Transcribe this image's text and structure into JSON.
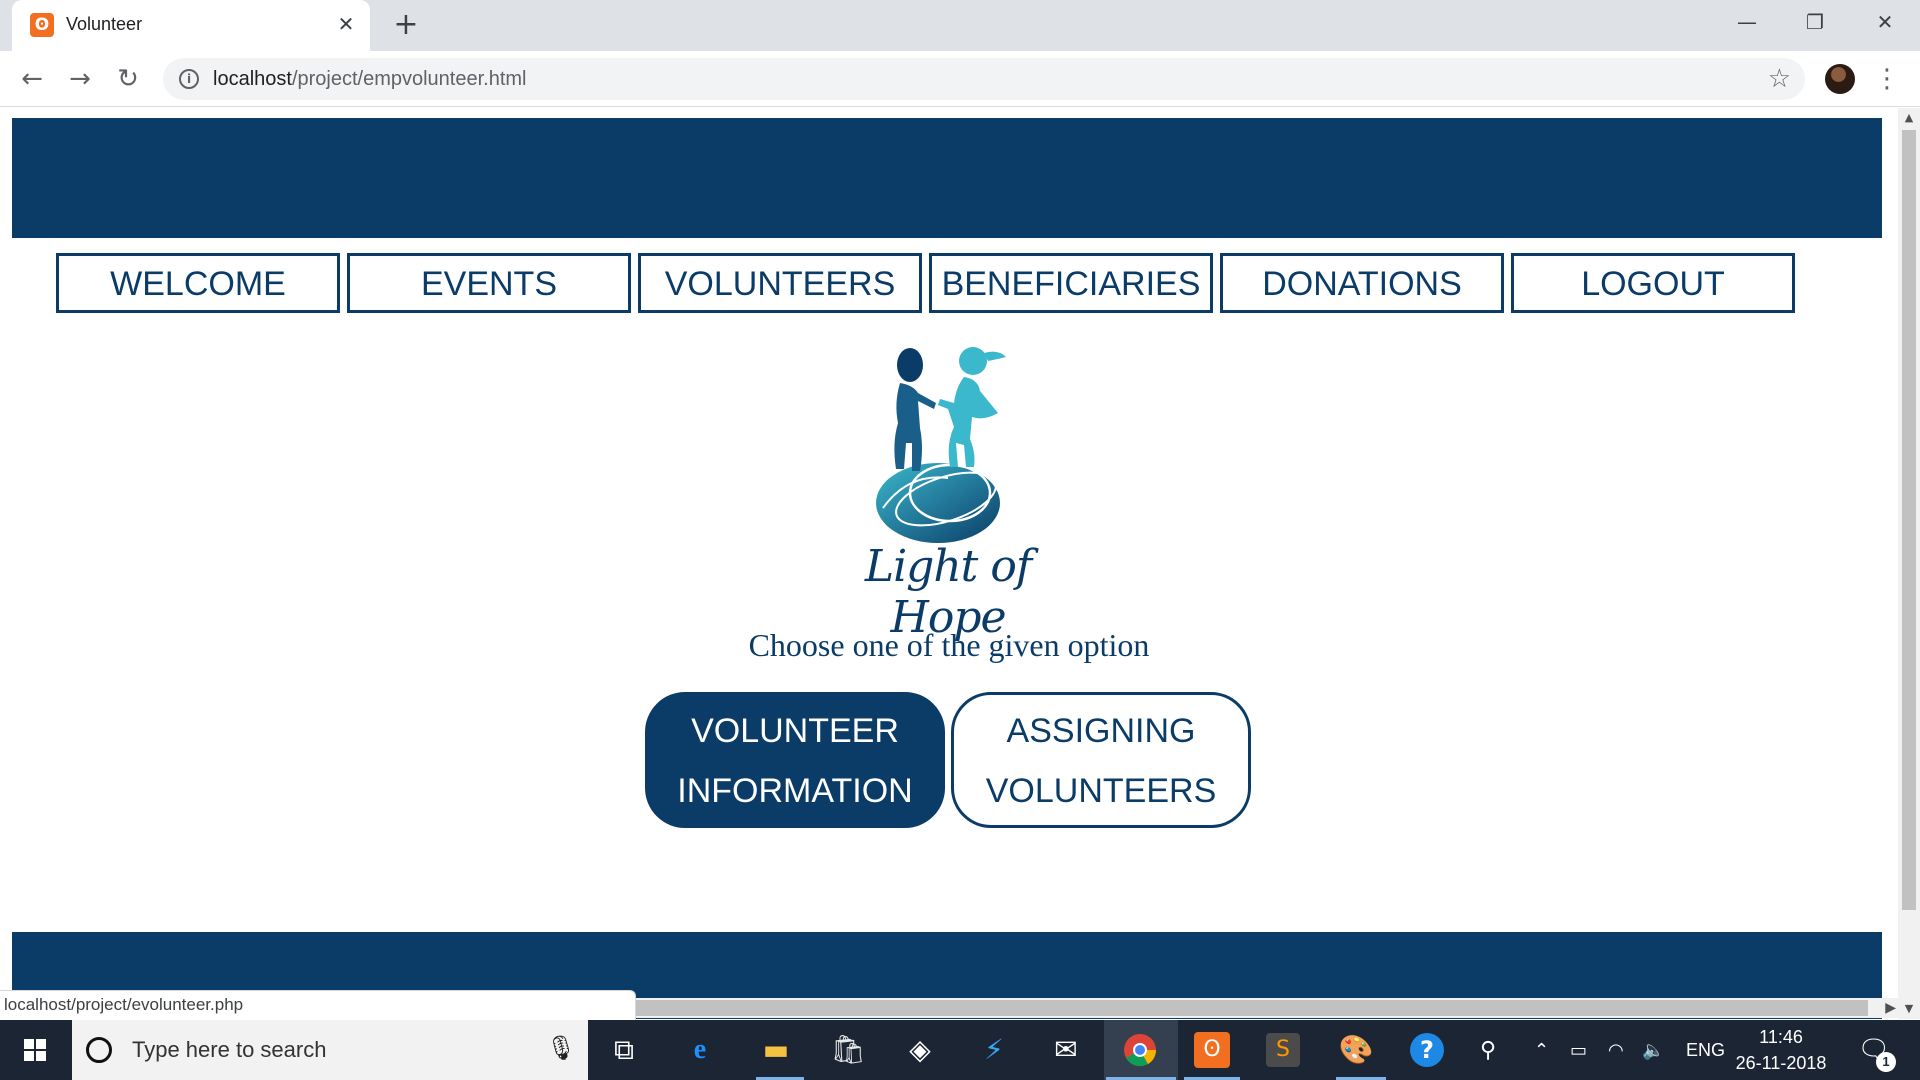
{
  "browser": {
    "tab_title": "Volunteer",
    "tab_favicon": "xampp-icon",
    "url_host": "localhost",
    "url_path": "/project/empvolunteer.html",
    "status_url": "localhost/project/evolunteer.php"
  },
  "site": {
    "nav": [
      {
        "label": "WELCOME"
      },
      {
        "label": "EVENTS"
      },
      {
        "label": "VOLUNTEERS"
      },
      {
        "label": "BENEFICIARIES"
      },
      {
        "label": "DONATIONS"
      },
      {
        "label": "LOGOUT"
      }
    ],
    "logo_text": "Light of Hope",
    "prompt": "Choose one of the given option",
    "choices": {
      "volunteer_info": {
        "line1": "VOLUNTEER",
        "line2": "INFORMATION"
      },
      "assigning": {
        "line1": "ASSIGNING",
        "line2": "VOLUNTEERS"
      }
    },
    "colors": {
      "primary": "#0b3c68",
      "logo_teal": "#3bb8cc"
    }
  },
  "taskbar": {
    "search_placeholder": "Type here to search",
    "language": "ENG",
    "time": "11:46",
    "date": "26-11-2018",
    "notification_count": "1"
  }
}
